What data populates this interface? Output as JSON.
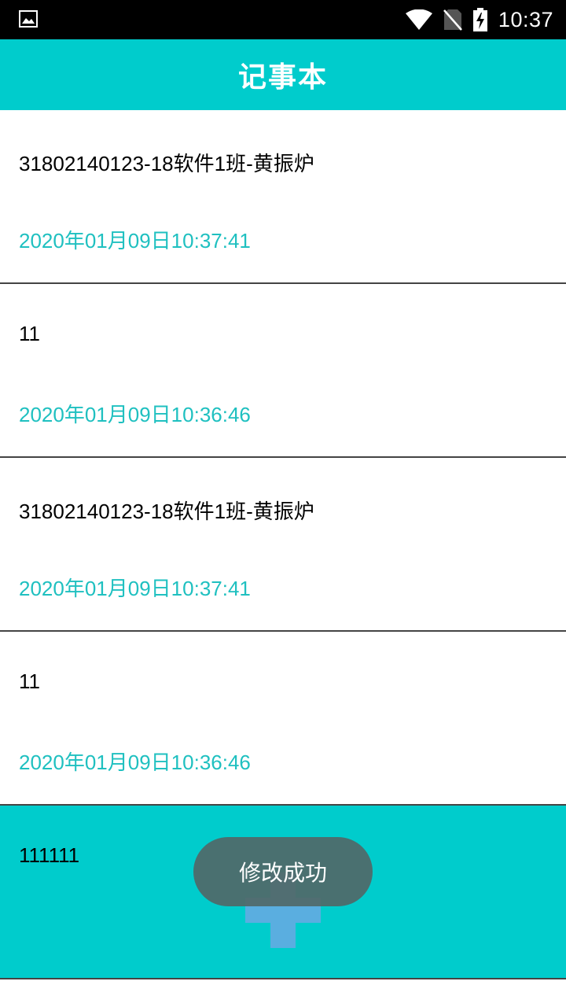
{
  "status_bar": {
    "time": "10:37",
    "icons": [
      "image-icon",
      "wifi-icon",
      "no-sim-icon",
      "battery-charging-icon"
    ]
  },
  "app_bar": {
    "title": "记事本"
  },
  "notes": [
    {
      "title": "31802140123-18软件1班-黄振炉",
      "time": "2020年01月09日10:37:41"
    },
    {
      "title": "11",
      "time": "2020年01月09日10:36:46"
    },
    {
      "title": "31802140123-18软件1班-黄振炉",
      "time": "2020年01月09日10:37:41"
    },
    {
      "title": "11",
      "time": "2020年01月09日10:36:46"
    },
    {
      "title": "111111",
      "time": ""
    }
  ],
  "fab": {
    "icon": "add-icon"
  },
  "toast": {
    "message": "修改成功"
  },
  "colors": {
    "accent": "#00CCCC",
    "time_text": "#1FC0C0",
    "toast_bg": "#506868"
  }
}
